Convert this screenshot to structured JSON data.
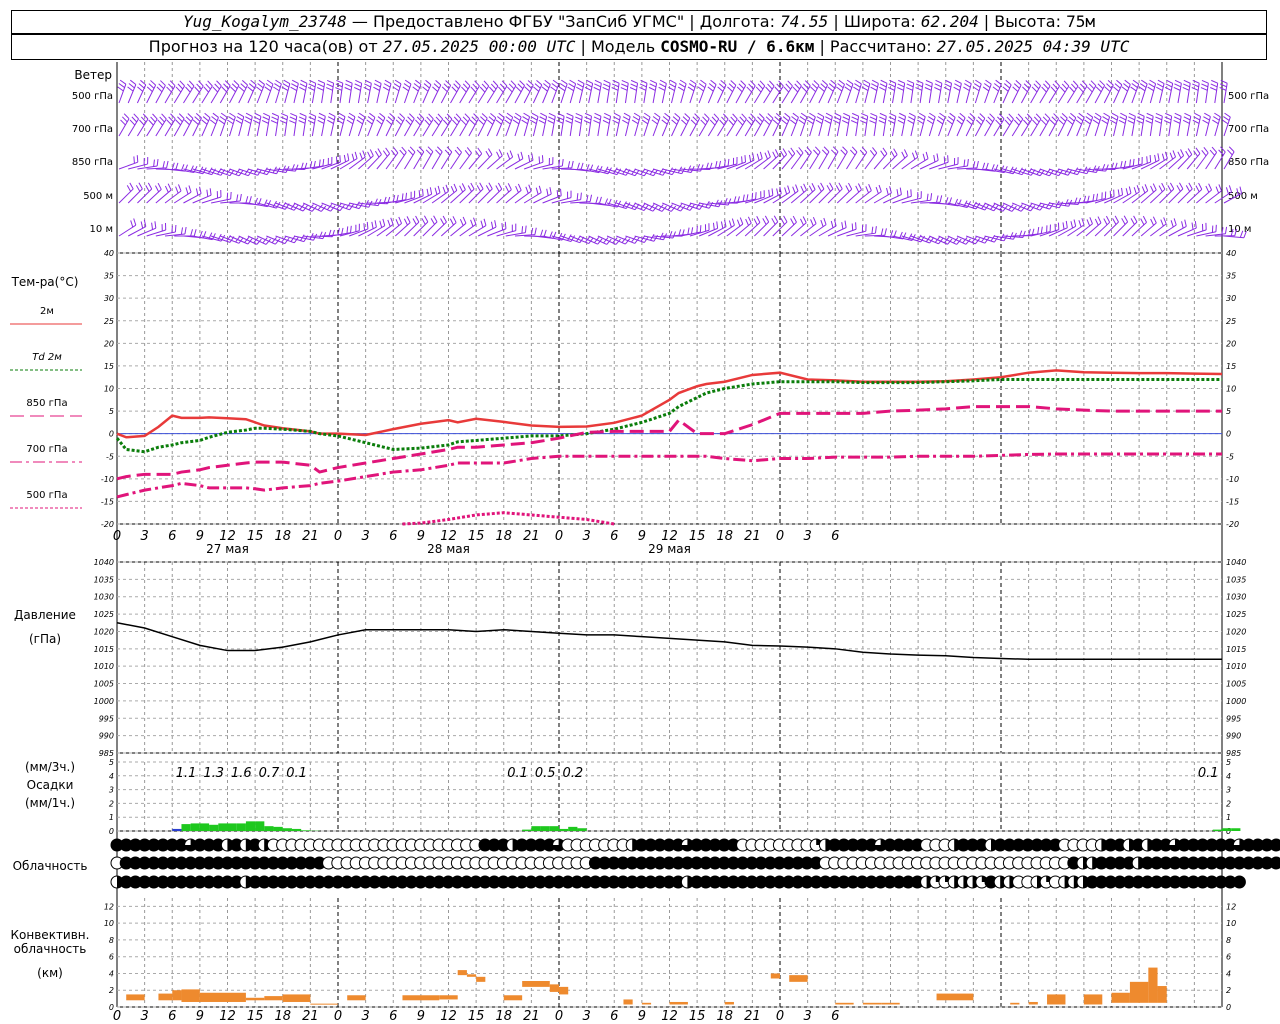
{
  "header": {
    "station": "Yug_Kogalym_23748",
    "provider": "— Предоставлено ФГБУ \"ЗапСиб УГМС\"",
    "lon_label": "| Долгота:",
    "lon": "74.55",
    "lat_label": "| Широта:",
    "lat": "62.204",
    "alt_label": "| Высота:",
    "alt": "75м",
    "forecast_prefix": "Прогноз на 120 часа(ов) от",
    "forecast_start": "27.05.2025 00:00 UTC",
    "model_label": "| Модель",
    "model": "COSMO-RU / 6.6км",
    "calc_label": "| Рассчитано:",
    "calc_time": "27.05.2025 04:39 UTC"
  },
  "wind_panel": {
    "title": "Ветер",
    "levels": [
      "500 гПа",
      "700 гПа",
      "850 гПа",
      "500 м",
      "10 м"
    ],
    "barb_color": "#8a2be2"
  },
  "x_axis": {
    "tick_labels": [
      "0",
      "3",
      "6",
      "9",
      "12",
      "15",
      "18",
      "21",
      "0",
      "3",
      "6",
      "9",
      "12",
      "15",
      "18",
      "21",
      "0",
      "3",
      "6",
      "9",
      "12",
      "15",
      "18",
      "21",
      "0",
      "3",
      "6"
    ],
    "day_labels": [
      "27 мая",
      "28 мая",
      "29 мая"
    ]
  },
  "chart_data": [
    {
      "type": "line",
      "title": "Тем-ра(°C)",
      "ylim": [
        -20,
        40
      ],
      "yticks": [
        "40",
        "35",
        "30",
        "25",
        "20",
        "15",
        "10",
        "5",
        "0",
        "-5",
        "-10",
        "-15",
        "-20"
      ],
      "x_hours": [
        0,
        1,
        3,
        4.5,
        6,
        7,
        9,
        10,
        12,
        14,
        15,
        16,
        18,
        21,
        22,
        24,
        27,
        30,
        33,
        36,
        37,
        39,
        42,
        45,
        48,
        51,
        54,
        57,
        60,
        61,
        63,
        64,
        66,
        69,
        72,
        75,
        78,
        81,
        84,
        87,
        90,
        93,
        96,
        99,
        102,
        105,
        108,
        111,
        114,
        117,
        120
      ],
      "series": [
        {
          "name": "2м",
          "color": "#e83a3a",
          "style": "solid",
          "values": [
            0,
            -0.8,
            -0.5,
            1.5,
            4,
            3.5,
            3.5,
            3.6,
            3.4,
            3.2,
            2.5,
            1.8,
            1.2,
            0.5,
            0,
            0,
            -0.3,
            1,
            2.2,
            3,
            2.5,
            3.3,
            2.6,
            1.8,
            1.5,
            1.6,
            2.4,
            4,
            7.5,
            9,
            10.5,
            11,
            11.5,
            13,
            13.5,
            12,
            11.8,
            11.5,
            11.5,
            11.5,
            11.6,
            12,
            12.5,
            13.5,
            14,
            13.6,
            13.5,
            13.4,
            13.4,
            13.3,
            13.2
          ]
        },
        {
          "name": "Td 2м",
          "color": "#0a7d0a",
          "style": "dotted",
          "values": [
            -1,
            -3.5,
            -4,
            -3,
            -2.5,
            -2,
            -1.5,
            -0.8,
            0.3,
            0.8,
            1.2,
            1.2,
            1,
            0.5,
            0,
            -0.5,
            -2,
            -3.5,
            -3.2,
            -2.5,
            -1.8,
            -1.5,
            -1,
            -0.5,
            -0.5,
            0,
            1,
            2.5,
            4.5,
            6,
            8,
            9,
            10,
            11,
            11.5,
            11.5,
            11.5,
            11.3,
            11.3,
            11.3,
            11.5,
            11.7,
            12,
            12,
            12,
            12,
            12,
            12,
            12,
            12,
            12
          ]
        },
        {
          "name": "850 гПа",
          "color": "#e0147a",
          "style": "longdash",
          "values": [
            -10,
            -9.5,
            -9,
            -9,
            -9,
            -8.5,
            -8,
            -7.5,
            -7,
            -6.5,
            -6.3,
            -6.3,
            -6.3,
            -7,
            -8.5,
            -7.5,
            -6.5,
            -5.5,
            -4.5,
            -3.5,
            -3,
            -3,
            -2.5,
            -2,
            -1,
            0.3,
            0.5,
            0.5,
            0.5,
            3,
            0,
            0,
            0,
            2,
            4.5,
            4.5,
            4.5,
            4.5,
            5,
            5.2,
            5.5,
            6,
            6,
            6,
            5.5,
            5.2,
            5,
            5,
            5,
            5,
            5
          ]
        },
        {
          "name": "700 гПа",
          "color": "#e0147a",
          "style": "dashdot",
          "values": [
            -14,
            -13.5,
            -12.5,
            -12,
            -11.5,
            -11,
            -11.5,
            -12,
            -12,
            -12,
            -12.2,
            -12.5,
            -12,
            -11.5,
            -11,
            -10.5,
            -9.5,
            -8.5,
            -8,
            -7,
            -6.5,
            -6.5,
            -6.5,
            -5.5,
            -5,
            -5,
            -5,
            -5,
            -5,
            -5,
            -5,
            -5,
            -5.5,
            -6,
            -5.5,
            -5.5,
            -5.2,
            -5.2,
            -5.2,
            -5,
            -5,
            -5,
            -4.8,
            -4.6,
            -4.5,
            -4.5,
            -4.5,
            -4.5,
            -4.5,
            -4.5,
            -4.5
          ]
        }
      ],
      "series_500": {
        "name": "500 гПа",
        "color": "#e0147a",
        "style": "dotted",
        "x_hours": [
          31,
          33,
          36,
          39,
          42,
          45,
          48,
          51,
          54
        ],
        "values": [
          -20,
          -19.8,
          -19,
          -18,
          -17.5,
          -18,
          -18.5,
          -19,
          -20
        ]
      },
      "zero_line_color": "#3b4fd8"
    },
    {
      "type": "line",
      "title": "Давление",
      "ylabel": "(гПа)",
      "ylim": [
        985,
        1040
      ],
      "yticks": [
        "1040",
        "1035",
        "1030",
        "1025",
        "1020",
        "1015",
        "1010",
        "1005",
        "1000",
        "995",
        "990",
        "985"
      ],
      "x_hours": [
        0,
        3,
        6,
        9,
        12,
        15,
        18,
        21,
        24,
        27,
        30,
        33,
        36,
        39,
        42,
        45,
        48,
        51,
        54,
        57,
        60,
        63,
        66,
        69,
        72,
        75,
        78,
        81,
        84,
        87,
        90,
        93,
        96,
        99,
        102,
        105,
        108,
        111,
        114,
        117,
        120
      ],
      "series": [
        {
          "name": "",
          "color": "#000000",
          "values": [
            1022.5,
            1021,
            1018.5,
            1016,
            1014.5,
            1014.5,
            1015.5,
            1017,
            1019,
            1020.5,
            1020.5,
            1020.5,
            1020.5,
            1020,
            1020.5,
            1020,
            1019.5,
            1019,
            1019,
            1018.5,
            1018,
            1017.5,
            1017,
            1016,
            1015.8,
            1015.5,
            1015,
            1014,
            1013.5,
            1013.2,
            1013,
            1012.5,
            1012.2,
            1012,
            1012,
            1012,
            1012,
            1012,
            1012,
            1012,
            1012
          ]
        }
      ]
    },
    {
      "type": "bar",
      "title": "Осадки",
      "ylabel_top": "(мм/3ч.)",
      "ylabel_bottom": "(мм/1ч.)",
      "ylim": [
        0,
        5
      ],
      "yticks": [
        "5",
        "4",
        "3",
        "2",
        "1",
        "0"
      ],
      "sum_labels": [
        {
          "hour": 7.5,
          "text": "1.1"
        },
        {
          "hour": 10.5,
          "text": "1.3"
        },
        {
          "hour": 13.5,
          "text": "1.6"
        },
        {
          "hour": 16.5,
          "text": "0.7"
        },
        {
          "hour": 19.5,
          "text": "0.1"
        },
        {
          "hour": 43.5,
          "text": "0.1"
        },
        {
          "hour": 46.5,
          "text": "0.5"
        },
        {
          "hour": 49.5,
          "text": "0.2"
        },
        {
          "hour": 118.5,
          "text": "0.1"
        }
      ],
      "hourly_values": [
        0,
        0,
        0,
        0,
        0,
        0,
        0.15,
        0.5,
        0.55,
        0.55,
        0.45,
        0.55,
        0.55,
        0.55,
        0.7,
        0.7,
        0.35,
        0.3,
        0.2,
        0.15,
        0.05,
        0.02,
        0,
        0,
        0,
        0,
        0,
        0,
        0,
        0,
        0,
        0,
        0,
        0,
        0,
        0,
        0,
        0,
        0,
        0,
        0,
        0,
        0,
        0,
        0.1,
        0.35,
        0.35,
        0.35,
        0.15,
        0.3,
        0.2,
        0,
        0,
        0,
        0,
        0,
        0,
        0,
        0,
        0,
        0,
        0,
        0,
        0,
        0,
        0,
        0,
        0,
        0,
        0,
        0,
        0,
        0,
        0,
        0,
        0,
        0,
        0,
        0,
        0,
        0,
        0,
        0,
        0,
        0,
        0,
        0,
        0,
        0,
        0,
        0,
        0,
        0,
        0,
        0,
        0,
        0,
        0,
        0,
        0,
        0,
        0,
        0,
        0,
        0,
        0,
        0,
        0,
        0,
        0,
        0,
        0,
        0,
        0,
        0,
        0,
        0,
        0,
        0,
        0.1,
        0.2,
        0.2
      ],
      "bar_color": "#1ec81e",
      "low_color": "#2a3fd0"
    },
    {
      "type": "table",
      "title": "Облачность",
      "rows": 3,
      "legend": "0 = clear, 1 = quarter, 2 = half, 3 = three-quarter, 4 = overcast",
      "data_upper": [
        4,
        4,
        4,
        4,
        4,
        4,
        4,
        4,
        3,
        4,
        4,
        4,
        2,
        4,
        2,
        4,
        2,
        0,
        0,
        0,
        0,
        0,
        0,
        0,
        0,
        0,
        0,
        0,
        0,
        0,
        0,
        0,
        0,
        0,
        0,
        0,
        0,
        0,
        0,
        0,
        4,
        4,
        4,
        2,
        4,
        4,
        4,
        4,
        3,
        0,
        0,
        0,
        0,
        0,
        0,
        0,
        2,
        4,
        4,
        4,
        4,
        4,
        3,
        4,
        4,
        4,
        4,
        4,
        0,
        0,
        0,
        0,
        0,
        0,
        0,
        0,
        1,
        2,
        4,
        4,
        4,
        4,
        4,
        3,
        4,
        4,
        4,
        4,
        0,
        0,
        0,
        2,
        4,
        4,
        4,
        2,
        4,
        4,
        4,
        4,
        4,
        4,
        4,
        0,
        0,
        0,
        0,
        2,
        4,
        4,
        2,
        4,
        2,
        4,
        4,
        3,
        4,
        4,
        4,
        4,
        4,
        4,
        3,
        4,
        4,
        4,
        4,
        4
      ],
      "data_mid": [
        0,
        4,
        4,
        4,
        4,
        4,
        4,
        4,
        4,
        4,
        4,
        4,
        4,
        4,
        4,
        4,
        4,
        4,
        4,
        4,
        4,
        4,
        4,
        0,
        0,
        0,
        0,
        0,
        0,
        0,
        0,
        0,
        0,
        0,
        0,
        0,
        0,
        0,
        0,
        0,
        0,
        0,
        0,
        0,
        0,
        0,
        0,
        0,
        0,
        0,
        0,
        0,
        4,
        4,
        4,
        4,
        4,
        4,
        4,
        4,
        4,
        4,
        4,
        4,
        4,
        4,
        4,
        4,
        4,
        4,
        4,
        4,
        4,
        4,
        4,
        4,
        4,
        0,
        0,
        0,
        0,
        0,
        0,
        0,
        0,
        0,
        0,
        0,
        0,
        0,
        0,
        0,
        0,
        0,
        0,
        0,
        0,
        0,
        0,
        0,
        0,
        0,
        0,
        0,
        4,
        2,
        2,
        4,
        4,
        4,
        4,
        2,
        4,
        4,
        4,
        4,
        4,
        4,
        4,
        4,
        4,
        4,
        4,
        4,
        4,
        4,
        4,
        4,
        4,
        4,
        4
      ],
      "data_lower": [
        2,
        4,
        4,
        4,
        4,
        4,
        4,
        4,
        4,
        4,
        4,
        4,
        4,
        4,
        2,
        4,
        4,
        4,
        4,
        4,
        4,
        4,
        4,
        4,
        4,
        4,
        4,
        4,
        4,
        4,
        4,
        4,
        4,
        4,
        4,
        4,
        4,
        4,
        4,
        4,
        4,
        4,
        4,
        4,
        4,
        4,
        4,
        4,
        4,
        4,
        4,
        4,
        4,
        4,
        4,
        4,
        4,
        4,
        4,
        4,
        4,
        4,
        2,
        4,
        4,
        4,
        4,
        4,
        4,
        4,
        4,
        4,
        4,
        4,
        4,
        4,
        4,
        4,
        4,
        4,
        4,
        4,
        4,
        4,
        4,
        4,
        4,
        4,
        2,
        1,
        1,
        2,
        2,
        2,
        1,
        4,
        2,
        2,
        0,
        0,
        2,
        1,
        0,
        2,
        2,
        2,
        4,
        4,
        4,
        4,
        4,
        4,
        4,
        4,
        4,
        4,
        4,
        4,
        4,
        4,
        4,
        4,
        4
      ]
    },
    {
      "type": "bar",
      "title": "Конвективн. облачность",
      "ylabel": "(км)",
      "ylim": [
        0,
        13
      ],
      "yticks": [
        "12",
        "10",
        "8",
        "6",
        "4",
        "2",
        "0"
      ],
      "bar_color": "#ee8a2e",
      "segments": [
        {
          "from": 1,
          "to": 3,
          "base": 0.8,
          "top": 1.5
        },
        {
          "from": 4.5,
          "to": 6,
          "base": 0.8,
          "top": 1.6
        },
        {
          "from": 6,
          "to": 7,
          "base": 0.8,
          "top": 2
        },
        {
          "from": 7,
          "to": 9,
          "base": 0.6,
          "top": 2.1
        },
        {
          "from": 9,
          "to": 12,
          "base": 0.6,
          "top": 1.7
        },
        {
          "from": 12,
          "to": 14,
          "base": 0.6,
          "top": 1.7
        },
        {
          "from": 14,
          "to": 16,
          "base": 0.8,
          "top": 1.1
        },
        {
          "from": 16,
          "to": 18,
          "base": 0.8,
          "top": 1.3
        },
        {
          "from": 18,
          "to": 21,
          "base": 0.6,
          "top": 1.5
        },
        {
          "from": 21,
          "to": 24,
          "base": 0.3,
          "top": 0.4
        },
        {
          "from": 25,
          "to": 27,
          "base": 0.8,
          "top": 1.4
        },
        {
          "from": 31,
          "to": 35,
          "base": 0.8,
          "top": 1.4
        },
        {
          "from": 35,
          "to": 37,
          "base": 0.9,
          "top": 1.4
        },
        {
          "from": 37,
          "to": 38,
          "base": 3.8,
          "top": 4.4
        },
        {
          "from": 38,
          "to": 39,
          "base": 3.6,
          "top": 3.9
        },
        {
          "from": 39,
          "to": 40,
          "base": 3,
          "top": 3.6
        },
        {
          "from": 42,
          "to": 44,
          "base": 0.8,
          "top": 1.4
        },
        {
          "from": 44,
          "to": 47,
          "base": 2.4,
          "top": 3.1
        },
        {
          "from": 47,
          "to": 48,
          "base": 1.8,
          "top": 2.7
        },
        {
          "from": 48,
          "to": 49,
          "base": 1.5,
          "top": 2.4
        },
        {
          "from": 55,
          "to": 56,
          "base": 0.3,
          "top": 0.9
        },
        {
          "from": 57,
          "to": 58,
          "base": 0.3,
          "top": 0.5
        },
        {
          "from": 60,
          "to": 62,
          "base": 0.3,
          "top": 0.6
        },
        {
          "from": 66,
          "to": 67,
          "base": 0.3,
          "top": 0.6
        },
        {
          "from": 71,
          "to": 72,
          "base": 3.4,
          "top": 4
        },
        {
          "from": 73,
          "to": 75,
          "base": 3,
          "top": 3.8
        },
        {
          "from": 78,
          "to": 80,
          "base": 0.3,
          "top": 0.5
        },
        {
          "from": 81,
          "to": 83,
          "base": 0.3,
          "top": 0.5
        },
        {
          "from": 83,
          "to": 85,
          "base": 0.3,
          "top": 0.5
        },
        {
          "from": 89,
          "to": 93,
          "base": 0.8,
          "top": 1.6
        },
        {
          "from": 97,
          "to": 98,
          "base": 0.3,
          "top": 0.5
        },
        {
          "from": 99,
          "to": 100,
          "base": 0.3,
          "top": 0.6
        },
        {
          "from": 101,
          "to": 103,
          "base": 0.3,
          "top": 1.5
        },
        {
          "from": 105,
          "to": 107,
          "base": 0.3,
          "top": 1.5
        },
        {
          "from": 108,
          "to": 110,
          "base": 0.5,
          "top": 1.7
        },
        {
          "from": 110,
          "to": 112,
          "base": 0.5,
          "top": 3
        },
        {
          "from": 112,
          "to": 113,
          "base": 0.5,
          "top": 4.7
        },
        {
          "from": 113,
          "to": 114,
          "base": 0.5,
          "top": 2.5
        }
      ]
    }
  ]
}
